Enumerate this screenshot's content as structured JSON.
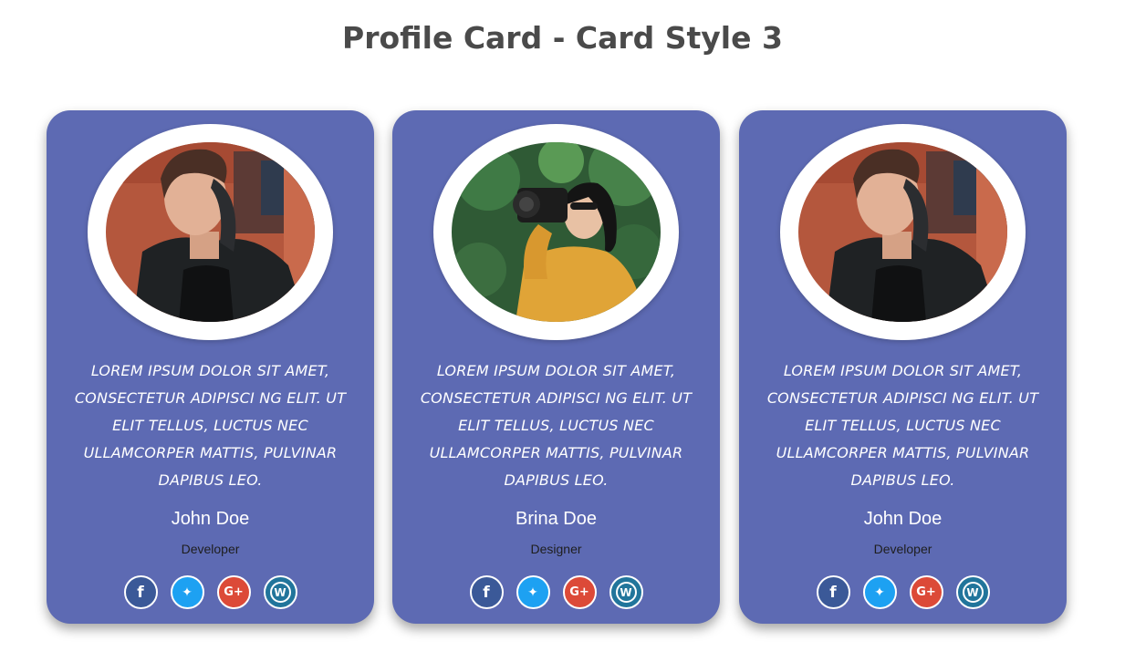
{
  "page": {
    "title": "Profile Card - Card Style 3"
  },
  "colors": {
    "card": "#5d6ab3",
    "facebook": "#3b5998",
    "twitter": "#1da1f2",
    "google_plus": "#dc4a38",
    "wordpress": "#21759b"
  },
  "cards": [
    {
      "photo": "man-in-leather-jacket",
      "quote": "Lorem ipsum dolor sit amet, consectetur adipisci ng elit. Ut elit tellus, luctus nec ullamcorper mattis, pulvinar dapibus leo.",
      "name": "John Doe",
      "role": "Developer",
      "socials": [
        {
          "icon": "facebook-icon",
          "glyph": "f"
        },
        {
          "icon": "twitter-icon",
          "glyph": "✦"
        },
        {
          "icon": "google-plus-icon",
          "glyph": "G+"
        },
        {
          "icon": "wordpress-icon",
          "glyph": "W"
        }
      ]
    },
    {
      "photo": "woman-with-camera",
      "quote": "Lorem ipsum dolor sit amet, consectetur adipisci ng elit. Ut elit tellus, luctus nec ullamcorper mattis, pulvinar dapibus leo.",
      "name": "Brina Doe",
      "role": "Designer",
      "socials": [
        {
          "icon": "facebook-icon",
          "glyph": "f"
        },
        {
          "icon": "twitter-icon",
          "glyph": "✦"
        },
        {
          "icon": "google-plus-icon",
          "glyph": "G+"
        },
        {
          "icon": "wordpress-icon",
          "glyph": "W"
        }
      ]
    },
    {
      "photo": "man-in-leather-jacket",
      "quote": "Lorem ipsum dolor sit amet, consectetur adipisci ng elit. Ut elit tellus, luctus nec ullamcorper mattis, pulvinar dapibus leo.",
      "name": "John Doe",
      "role": "Developer",
      "socials": [
        {
          "icon": "facebook-icon",
          "glyph": "f"
        },
        {
          "icon": "twitter-icon",
          "glyph": "✦"
        },
        {
          "icon": "google-plus-icon",
          "glyph": "G+"
        },
        {
          "icon": "wordpress-icon",
          "glyph": "W"
        }
      ]
    }
  ]
}
